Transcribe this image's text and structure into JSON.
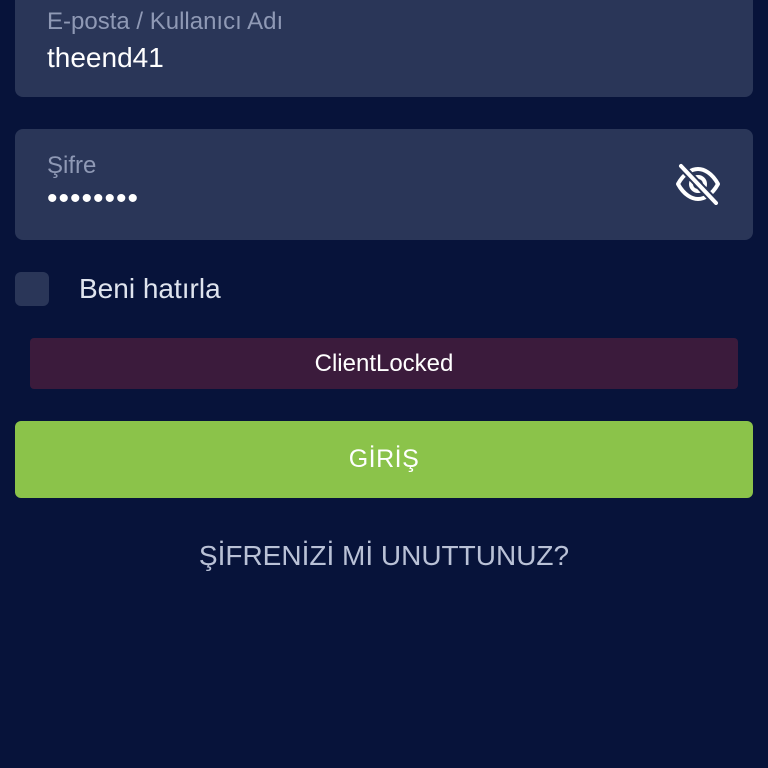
{
  "login_form": {
    "username": {
      "label": "E-posta / Kullanıcı Adı",
      "value": "theend41"
    },
    "password": {
      "label": "Şifre",
      "value": "••••••••",
      "visibility_icon": "eye-off-icon"
    },
    "remember_me": {
      "label": "Beni hatırla",
      "checked": false
    },
    "error_message": "ClientLocked",
    "submit_label": "GİRİŞ",
    "forgot_password_label": "ŞİFRENİZİ Mİ UNUTTUNUZ?"
  },
  "colors": {
    "background": "#07133a",
    "field_background": "#2a3658",
    "error_background": "#3b1b3c",
    "button": "#8bc34a"
  }
}
